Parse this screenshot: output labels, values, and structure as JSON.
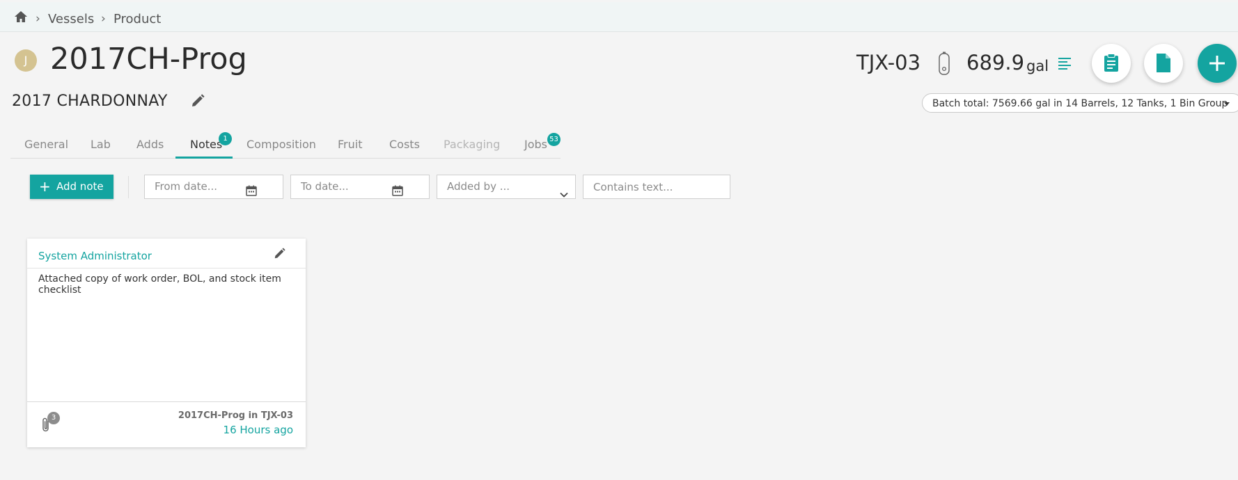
{
  "breadcrumb": {
    "items": [
      "Vessels",
      "Product"
    ],
    "separator": "›"
  },
  "header": {
    "avatar_initial": "J",
    "lot_code": "2017CH-Prog",
    "lot_description": "2017 CHARDONNAY",
    "vessel_code": "TJX-03",
    "volume": "689.9",
    "volume_unit": "gal",
    "batch_total": "Batch total: 7569.66 gal in 14 Barrels, 12 Tanks, 1 Bin Group"
  },
  "tabs": [
    {
      "label": "General"
    },
    {
      "label": "Lab"
    },
    {
      "label": "Adds"
    },
    {
      "label": "Notes",
      "badge": "1",
      "active": true
    },
    {
      "label": "Composition"
    },
    {
      "label": "Fruit"
    },
    {
      "label": "Costs"
    },
    {
      "label": "Packaging",
      "disabled": true
    },
    {
      "label": "Jobs",
      "badge": "53"
    }
  ],
  "toolbar": {
    "add_note_label": "Add note",
    "from_date_placeholder": "From date...",
    "to_date_placeholder": "To date...",
    "added_by_placeholder": "Added by ...",
    "contains_text_placeholder": "Contains text..."
  },
  "notes": [
    {
      "author": "System Administrator",
      "body": "Attached copy of work order, BOL, and stock item checklist",
      "attachment_count": "3",
      "location": "2017CH-Prog in TJX-03",
      "time_ago": "16 Hours ago"
    }
  ],
  "colors": {
    "accent": "#14a4a0",
    "avatar": "#d4c391",
    "background": "#f4f4f4"
  },
  "icons": [
    "home-icon",
    "edit-icon",
    "tank-icon",
    "list-icon",
    "clipboard-icon",
    "document-icon",
    "plus-icon",
    "calendar-icon",
    "chevron-down-icon",
    "paperclip-icon"
  ]
}
